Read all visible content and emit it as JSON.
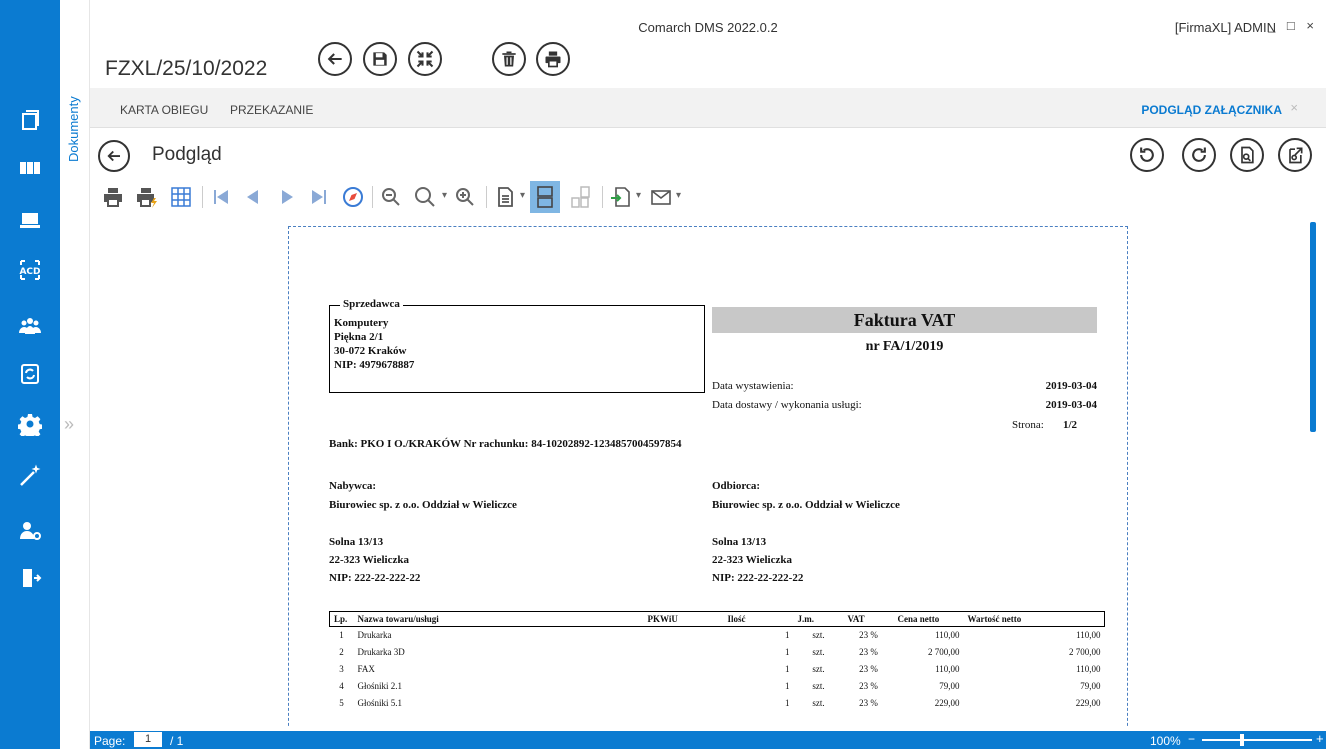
{
  "app": {
    "title": "Comarch DMS 2022.0.2",
    "user": "[FirmaXL]  ADMIN",
    "window_controls": "_ □ ×",
    "document_id": "FZXL/25/10/2022"
  },
  "sidebar": {
    "vertical_label": "Dokumenty",
    "expand_glyph": "»",
    "items": [
      "documents-icon",
      "panels-icon",
      "monitor-icon",
      "acd-icon",
      "users-icon",
      "refresh-doc-icon",
      "gear-icon",
      "wand-icon",
      "user-settings-icon",
      "exit-icon"
    ]
  },
  "tabs": {
    "karta": "KARTA OBIEGU",
    "przekazanie": "PRZEKAZANIE",
    "podglad": "PODGLĄD ZAŁĄCZNIKA",
    "close": "×"
  },
  "preview": {
    "title": "Podgląd"
  },
  "invoice": {
    "seller_legend": "Sprzedawca",
    "seller_lines": [
      "Komputery",
      "Piękna 2/1",
      "30-072 Kraków",
      "NIP: 4979678887"
    ],
    "title": "Faktura VAT",
    "number": "nr FA/1/2019",
    "issue_label": "Data wystawienia:",
    "issue_date": "2019-03-04",
    "delivery_label": "Data dostawy / wykonania usługi:",
    "delivery_date": "2019-03-04",
    "page_label": "Strona:",
    "page_value": "1/2",
    "bank_line": "Bank: PKO I O./KRAKÓW   Nr rachunku: 84-10202892-1234857004597854",
    "buyer_label": "Nabywca:",
    "buyer_name": "Biurowiec sp. z o.o. Oddział w Wieliczce",
    "buyer_street": "Solna 13/13",
    "buyer_city": "22-323 Wieliczka",
    "buyer_nip": "NIP: 222-22-222-22",
    "recipient_label": "Odbiorca:",
    "recipient_name": "Biurowiec sp. z o.o. Oddział w Wieliczce",
    "recipient_street": "Solna 13/13",
    "recipient_city": "22-323 Wieliczka",
    "recipient_nip": "NIP: 222-22-222-22",
    "columns": [
      "Lp.",
      "Nazwa towaru/usługi",
      "PKWiU",
      "Ilość",
      "J.m.",
      "VAT",
      "Cena netto",
      "Wartość netto"
    ],
    "rows": [
      [
        "1",
        "Drukarka",
        "",
        "1",
        "szt.",
        "23 %",
        "110,00",
        "110,00"
      ],
      [
        "2",
        "Drukarka 3D",
        "",
        "1",
        "szt.",
        "23 %",
        "2 700,00",
        "2 700,00"
      ],
      [
        "3",
        "FAX",
        "",
        "1",
        "szt.",
        "23 %",
        "110,00",
        "110,00"
      ],
      [
        "4",
        "Głośniki 2.1",
        "",
        "1",
        "szt.",
        "23 %",
        "79,00",
        "79,00"
      ],
      [
        "5",
        "Głośniki 5.1",
        "",
        "1",
        "szt.",
        "23 %",
        "229,00",
        "229,00"
      ]
    ]
  },
  "status": {
    "page_label": "Page:",
    "page_value": "1",
    "page_total": "/ 1",
    "zoom": "100%"
  },
  "colors": {
    "accent": "#0b7bd1"
  }
}
